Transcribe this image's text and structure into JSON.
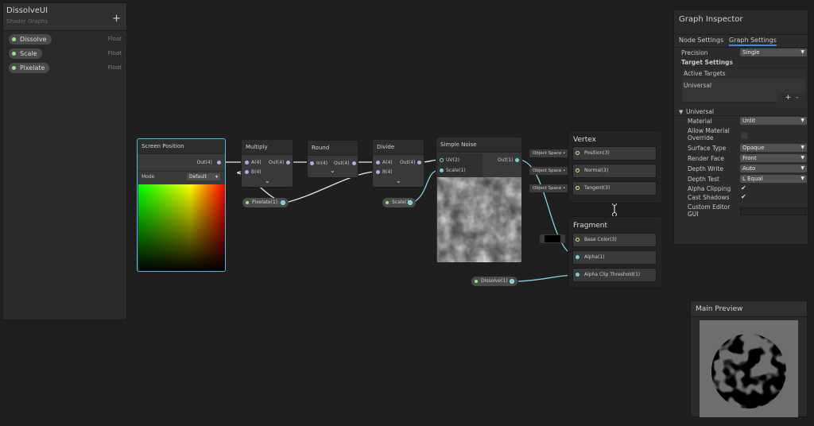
{
  "blackboard": {
    "title": "DissolveUI",
    "subtitle": "Shader Graphs",
    "add_label": "+",
    "properties": [
      {
        "name": "Dissolve",
        "type": "Float"
      },
      {
        "name": "Scale",
        "type": "Float"
      },
      {
        "name": "Pixelate",
        "type": "Float"
      }
    ]
  },
  "nodes": {
    "screen_position": {
      "title": "Screen Position",
      "out": "Out(4)",
      "mode_label": "Mode",
      "mode_value": "Default"
    },
    "multiply": {
      "title": "Multiply",
      "in_a": "A(4)",
      "in_b": "B(4)",
      "out": "Out(4)"
    },
    "round": {
      "title": "Round",
      "in": "In(4)",
      "out": "Out(4)"
    },
    "divide": {
      "title": "Divide",
      "in_a": "A(4)",
      "in_b": "B(4)",
      "out": "Out(4)"
    },
    "simple_noise": {
      "title": "Simple Noise",
      "in_uv": "UV(2)",
      "in_scale": "Scale(1)",
      "out": "Out(1)"
    }
  },
  "pills": {
    "pixelate": "Pixelate(1)",
    "scale": "Scale(1)",
    "dissolve": "Dissolve(1)"
  },
  "vertex": {
    "title": "Vertex",
    "space_label": "Object Space",
    "blocks": [
      "Position(3)",
      "Normal(3)",
      "Tangent(3)"
    ]
  },
  "fragment": {
    "title": "Fragment",
    "blocks": [
      "Base Color(3)",
      "Alpha(1)",
      "Alpha Clip Threshold(1)"
    ]
  },
  "inspector": {
    "title": "Graph Inspector",
    "tabs": [
      "Node Settings",
      "Graph Settings"
    ],
    "precision_label": "Precision",
    "precision_value": "Single",
    "target_settings": "Target Settings",
    "active_targets": "Active Targets",
    "target_item": "Universal",
    "plus": "+",
    "minus": "-",
    "section": "Universal",
    "rows": [
      {
        "label": "Material",
        "value": "Unlit",
        "kind": "drop"
      },
      {
        "label": "Allow Material Override",
        "value": "",
        "kind": "check-empty"
      },
      {
        "label": "Surface Type",
        "value": "Opaque",
        "kind": "drop"
      },
      {
        "label": "Render Face",
        "value": "Front",
        "kind": "drop"
      },
      {
        "label": "Depth Write",
        "value": "Auto",
        "kind": "drop"
      },
      {
        "label": "Depth Test",
        "value": "L Equal",
        "kind": "drop"
      },
      {
        "label": "Alpha Clipping",
        "value": "✔",
        "kind": "check"
      },
      {
        "label": "Cast Shadows",
        "value": "✔",
        "kind": "check"
      },
      {
        "label": "Custom Editor GUI",
        "value": "",
        "kind": "text"
      }
    ]
  },
  "preview": {
    "title": "Main Preview"
  },
  "colors": {
    "wire_blue": "#7fd6e4",
    "wire_white": "#dcdcdc",
    "selection": "#44c0e8",
    "property_dot": "#9be28b"
  }
}
